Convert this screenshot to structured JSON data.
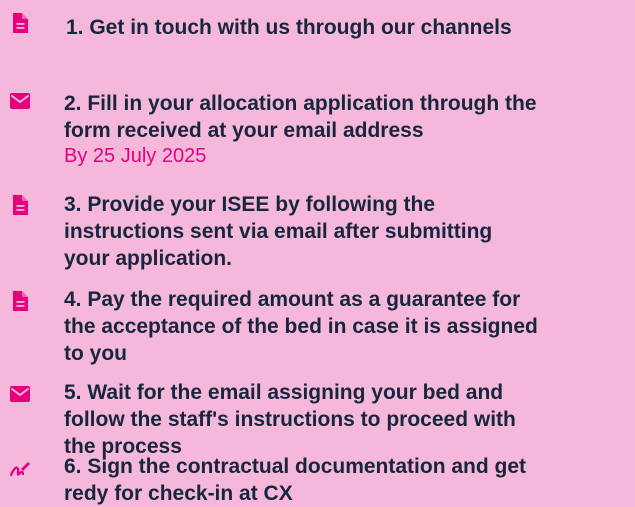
{
  "colors": {
    "background": "#f5b8da",
    "accent": "#e5007e",
    "text": "#17263f"
  },
  "steps": [
    {
      "icon": "document-icon",
      "lines": [
        "1. Get in touch with us through our channels"
      ]
    },
    {
      "icon": "mail-icon",
      "lines": [
        "2. Fill in your allocation application through the",
        "form received at your email address"
      ],
      "note": "By 25 July 2025"
    },
    {
      "icon": "document-icon",
      "lines": [
        "3. Provide your ISEE by following the",
        "instructions sent via email after submitting",
        "your application."
      ]
    },
    {
      "icon": "document-icon",
      "lines": [
        "4. Pay the required amount as a guarantee for",
        "the acceptance of the bed in case it is assigned",
        "to you"
      ]
    },
    {
      "icon": "mail-icon",
      "lines": [
        "5. Wait for the email assigning your bed and",
        "follow the staff's instructions to proceed with",
        "the process"
      ]
    },
    {
      "icon": "signature-icon",
      "lines": [
        "6. Sign the contractual documentation and get",
        "redy for check-in at CX"
      ]
    }
  ]
}
